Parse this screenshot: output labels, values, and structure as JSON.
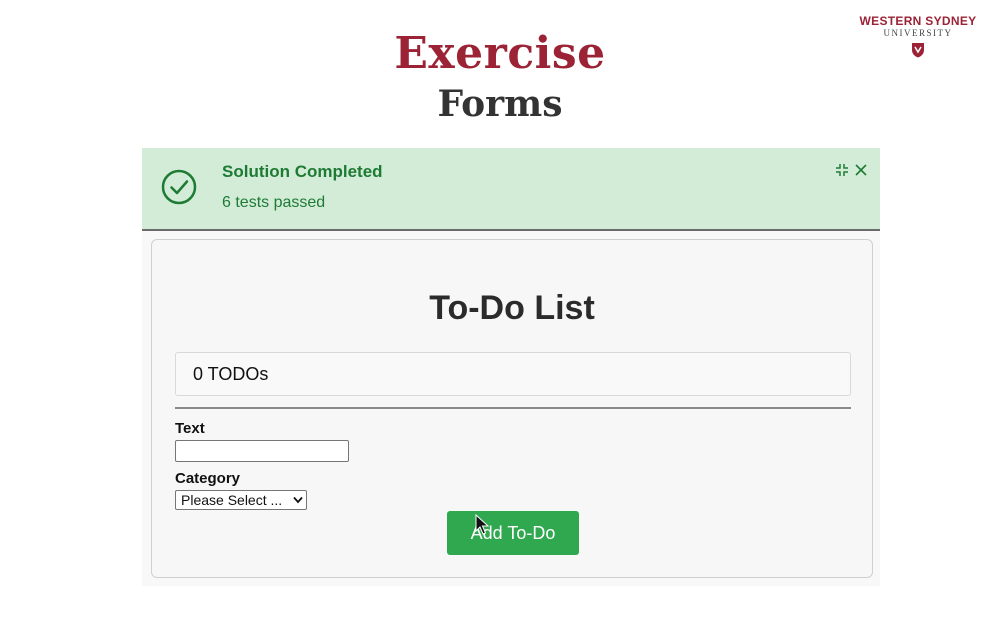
{
  "slide": {
    "title": "Exercise",
    "subtitle": "Forms",
    "title_color": "#9b2335",
    "logo_line1": "WESTERN SYDNEY",
    "logo_line2": "UNIVERSITY",
    "logo_color": "#9b2335"
  },
  "banner": {
    "title": "Solution Completed",
    "subtitle": "6 tests passed",
    "background": "#d3ecd8",
    "text_color": "#1e7b34",
    "icons": [
      "check-circle-icon",
      "collapse-icon",
      "close-icon"
    ]
  },
  "app": {
    "title": "To-Do List",
    "count_text": "0 TODOs",
    "text_label": "Text",
    "text_value": "",
    "category_label": "Category",
    "category_selected": "Please Select ...",
    "add_button_label": "Add To-Do",
    "add_button_color": "#2fa84f"
  }
}
